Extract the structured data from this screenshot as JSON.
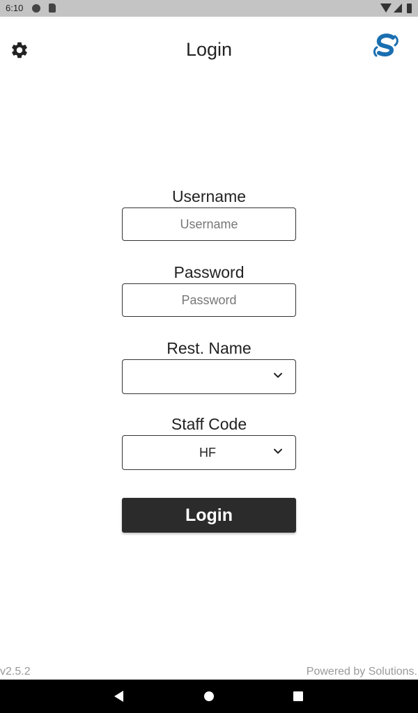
{
  "status_bar": {
    "time": "6:10"
  },
  "header": {
    "title": "Login"
  },
  "form": {
    "username": {
      "label": "Username",
      "placeholder": "Username",
      "value": ""
    },
    "password": {
      "label": "Password",
      "placeholder": "Password",
      "value": ""
    },
    "rest_name": {
      "label": "Rest. Name",
      "selected": ""
    },
    "staff_code": {
      "label": "Staff Code",
      "selected": "HF"
    },
    "login_label": "Login"
  },
  "footer": {
    "version": "v2.5.2",
    "powered_by": "Powered by Solutions."
  },
  "colors": {
    "brand_blue": "#1a6fb0",
    "button_dark": "#2b2b2b",
    "status_bar": "#c4c4c4"
  },
  "icons": {
    "settings": "gear-icon",
    "brand": "brand-logo-icon",
    "dropdown": "chevron-down-icon",
    "nav": [
      "back-icon",
      "home-icon",
      "recents-icon"
    ]
  }
}
